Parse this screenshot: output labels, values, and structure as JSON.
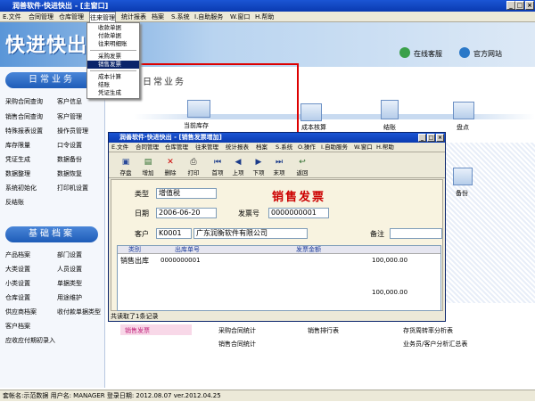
{
  "window": {
    "title": "润善软件·快进快出 - [主窗口]"
  },
  "menubar": [
    "E.文件",
    "合同管理",
    "仓库管理",
    "往来管理",
    "统计报表",
    "档案",
    "S.系统",
    "I.自助服务",
    "W.窗口",
    "H.帮助"
  ],
  "banner": {
    "logo": "快进快出",
    "service": "在线客服",
    "website": "官方网站"
  },
  "dropdown": {
    "items": [
      "收款单据",
      "付款单据",
      "往来明细账",
      "采购发票",
      "销售发票",
      "成本计算",
      "结账",
      "凭证生成"
    ],
    "selected": "销售发票"
  },
  "sidebar": {
    "section1": "日常业务",
    "items1": [
      "采购合同查询",
      "客户信息",
      "销售合同查询",
      "客户管理",
      "特殊报表设置",
      "操作员管理",
      "库存限量",
      "口令设置",
      "凭证生成",
      "数据备份",
      "数据整理",
      "数据恢复",
      "系统初始化",
      "打印机设置",
      "反结账"
    ],
    "section2": "基础档案",
    "items2": [
      "产品档案",
      "部门设置",
      "大类设置",
      "人员设置",
      "小类设置",
      "单据类型",
      "仓库设置",
      "用途维护",
      "供应商档案",
      "收付款单据类型",
      "客户档案",
      "应收应付期初录入"
    ]
  },
  "main": {
    "section_label": "日常业务"
  },
  "flow": {
    "stock": "当前库存",
    "cost": "成本核算",
    "close": "结账",
    "inventory": "盘点",
    "backup": "备份"
  },
  "child": {
    "title": "润善软件·快进快出 - [销售发票增加]",
    "menu": [
      "E.文件",
      "合同管理",
      "仓库管理",
      "往来管理",
      "统计报表",
      "档案",
      "S.系统",
      "O.操作",
      "I.自助服务",
      "W.窗口",
      "H.帮助"
    ],
    "toolbar": [
      {
        "label": "存盘",
        "icon": "save-icon",
        "glyph": "▣"
      },
      {
        "label": "增加",
        "icon": "add-icon",
        "glyph": "▤"
      },
      {
        "label": "删除",
        "icon": "delete-icon",
        "glyph": "✕"
      },
      {
        "label": "打印",
        "icon": "print-icon",
        "glyph": "⎙"
      },
      {
        "label": "首项",
        "icon": "first-icon",
        "glyph": "⏮"
      },
      {
        "label": "上项",
        "icon": "prev-icon",
        "glyph": "◀"
      },
      {
        "label": "下项",
        "icon": "next-icon",
        "glyph": "▶"
      },
      {
        "label": "末项",
        "icon": "last-icon",
        "glyph": "⏭"
      },
      {
        "label": "返回",
        "icon": "return-icon",
        "glyph": "↩"
      }
    ],
    "form": {
      "type_label": "类型",
      "type_value": "增值税",
      "heading": "销售发票",
      "date_label": "日期",
      "date_value": "2006-06-20",
      "invoice_no_label": "发票号",
      "invoice_no_value": "0000000001",
      "customer_label": "客户",
      "customer_code": "K0001",
      "customer_name": "广东润衡软件有限公司",
      "remark_label": "备注",
      "remark_value": ""
    },
    "grid": {
      "headers": [
        "类别",
        "出库单号",
        "发票金额"
      ],
      "rows": [
        {
          "category": "销售出库",
          "out_no": "0000000001",
          "amount": "100,000.00"
        }
      ],
      "total": "100,000.00"
    },
    "status": "共读取了1条记录"
  },
  "links": {
    "sales_invoice": "销售发票",
    "purchase_stats": "采购合同统计",
    "sales_rank": "销售排行表",
    "turnover": "存货周转率分析表",
    "sales_stats": "销售合同统计",
    "clerk_report": "业务员/客户分析汇总表"
  },
  "statusbar": {
    "text": "套帐名:示范数据   用户名: MANAGER   登录日期: 2012.08.07   ver.2012.04.25"
  },
  "colors": {
    "title_blue": "#0a3ab0",
    "invoice_red": "#cc0000",
    "arrow_red": "#dd0000"
  }
}
